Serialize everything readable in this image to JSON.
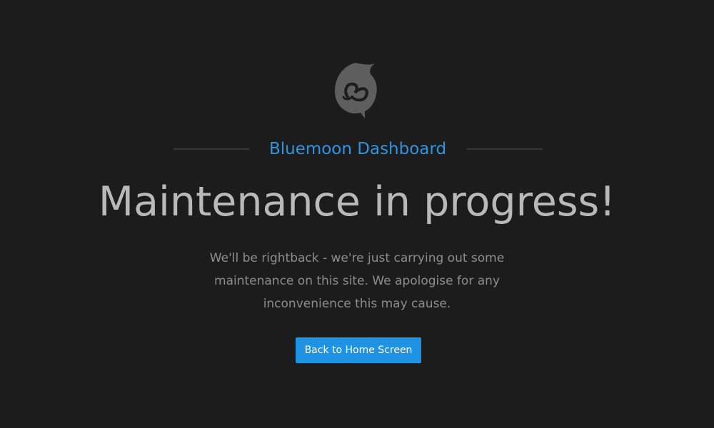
{
  "logo": {
    "icon": "bluemoon-logo-icon",
    "color": "#5e5e5f"
  },
  "brand": {
    "title": "Bluemoon Dashboard",
    "color": "#2d95e0"
  },
  "headline": "Maintenance in progress!",
  "message": "We'll be rightback - we're just carrying out some maintenance on this site. We apologise for any inconvenience this may cause.",
  "button": {
    "label": "Back to Home Screen",
    "color": "#1e92e3"
  },
  "colors": {
    "background": "#1c1c1d",
    "headline": "#b9b9b9",
    "message": "#8d8d8d"
  }
}
